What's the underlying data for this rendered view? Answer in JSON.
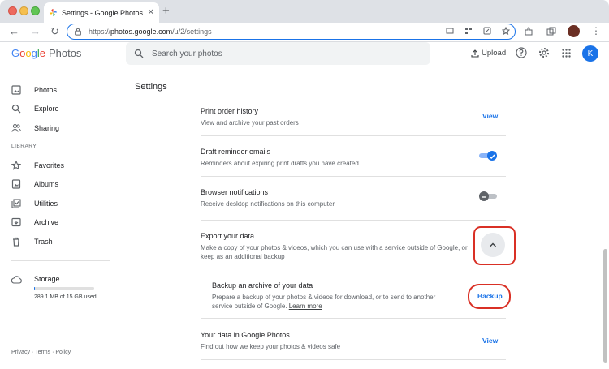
{
  "browser": {
    "tab_title": "Settings - Google Photos",
    "tab_close": "✕",
    "new_tab": "+",
    "url_scheme": "https://",
    "url_host": "photos.google.com",
    "url_path": "/u/2/settings",
    "nav_back": "←",
    "nav_forward": "→",
    "nav_reload": "↻",
    "menu": "⋮"
  },
  "header": {
    "logo_letters": [
      "G",
      "o",
      "o",
      "g",
      "l",
      "e"
    ],
    "product": "Photos",
    "search_placeholder": "Search your photos",
    "upload_label": "Upload",
    "avatar_letter": "K"
  },
  "sidebar": {
    "items": [
      {
        "label": "Photos",
        "icon": "photo-icon"
      },
      {
        "label": "Explore",
        "icon": "search-icon"
      },
      {
        "label": "Sharing",
        "icon": "people-icon"
      }
    ],
    "library_label": "LIBRARY",
    "library_items": [
      {
        "label": "Favorites",
        "icon": "star-icon"
      },
      {
        "label": "Albums",
        "icon": "album-icon"
      },
      {
        "label": "Utilities",
        "icon": "utilities-icon"
      },
      {
        "label": "Archive",
        "icon": "archive-icon"
      },
      {
        "label": "Trash",
        "icon": "trash-icon"
      }
    ],
    "storage_label": "Storage",
    "storage_text": "289.1 MB of 15 GB used",
    "storage_fraction": 0.02,
    "footer_privacy": "Privacy",
    "footer_sep1": "·",
    "footer_terms": "Terms",
    "footer_sep2": "·",
    "footer_policy": "Policy"
  },
  "main": {
    "page_title": "Settings",
    "rows": [
      {
        "title": "Print order history",
        "subtitle": "View and archive your past orders",
        "action": "View"
      },
      {
        "title": "Draft reminder emails",
        "subtitle": "Reminders about expiring print drafts you have created",
        "toggle": true
      },
      {
        "title": "Browser notifications",
        "subtitle": "Receive desktop notifications on this computer",
        "toggle": false
      },
      {
        "title": "Export your data",
        "subtitle": "Make a copy of your photos & videos, which you can use with a service outside of Google, or keep as an additional backup"
      },
      {
        "title": "Backup an archive of your data",
        "subtitle": "Prepare a backup of your photos & videos for download, or to send to another service outside of Google.",
        "link": "Learn more",
        "action": "Backup"
      },
      {
        "title": "Your data in Google Photos",
        "subtitle": "Find out how we keep your photos & videos safe",
        "action": "View"
      }
    ]
  },
  "colors": {
    "accent": "#1a73e8",
    "highlight_ring": "#d93025"
  }
}
